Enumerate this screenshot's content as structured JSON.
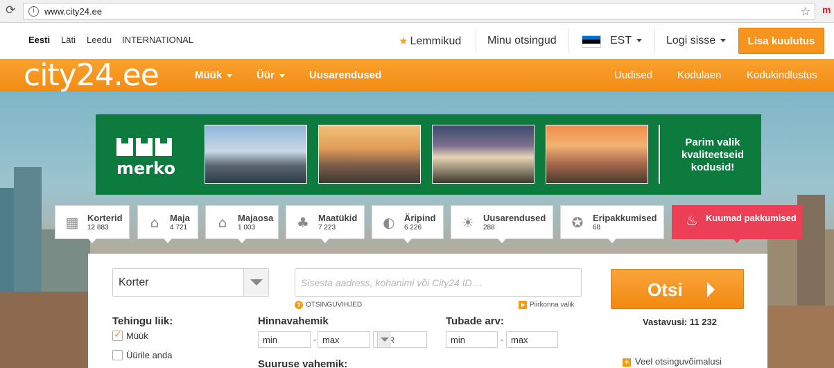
{
  "browser": {
    "url": "www.city24.ee"
  },
  "languages": [
    {
      "label": "Eesti",
      "active": true
    },
    {
      "label": "Läti",
      "active": false
    },
    {
      "label": "Leedu",
      "active": false
    },
    {
      "label": "INTERNATIONAL",
      "active": false
    }
  ],
  "topnav": {
    "favorites": "Lemmikud",
    "my_searches": "Minu otsingud",
    "language": "EST",
    "login": "Logi sisse",
    "add_listing": "Lisa kuulutus"
  },
  "mainnav": {
    "logo": "city24.ee",
    "left": [
      "Müük",
      "Üür",
      "Uusarendused"
    ],
    "right": [
      "Uudised",
      "Kodulaen",
      "Kodukindlustus"
    ]
  },
  "banner": {
    "brand": "merko",
    "tagline": "Parim valik kvaliteetseid kodusid!"
  },
  "categories": [
    {
      "label": "Korterid",
      "count": "12 883",
      "icon": "apartment-icon"
    },
    {
      "label": "Maja",
      "count": "4 721",
      "icon": "house-icon"
    },
    {
      "label": "Majaosa",
      "count": "1 003",
      "icon": "house-part-icon"
    },
    {
      "label": "Maatükid",
      "count": "7 223",
      "icon": "land-icon"
    },
    {
      "label": "Äripind",
      "count": "6 226",
      "icon": "commercial-icon"
    },
    {
      "label": "Uusarendused",
      "count": "288",
      "icon": "new-development-icon"
    },
    {
      "label": "Eripakkumised",
      "count": "68",
      "icon": "special-offer-icon"
    },
    {
      "label": "Kuumad pakkumised",
      "count": "",
      "icon": "flame-icon"
    }
  ],
  "search": {
    "property_type": "Korter",
    "address_placeholder": "Sisesta aadress, kohanimi või City24 ID ...",
    "tips": "OTSINGUVIHJED",
    "nearby": "Piirkonna valik",
    "button": "Otsi",
    "matches": "Vastavusi: 11 232",
    "deal_type_label": "Tehingu liik:",
    "deal_sale": "Müük",
    "deal_rent": "Üürile anda",
    "price_label": "Hinnavahemik",
    "min": "min",
    "max": "max",
    "currency": "EUR",
    "rooms_label": "Tubade arv:",
    "size_label": "Suuruse vahemik:",
    "more_options": "Veel otsinguvõimalusi"
  },
  "colors": {
    "brand_orange": "#f7941d",
    "merko_green": "#0d7a3e",
    "hot_red": "#ec3e55"
  }
}
